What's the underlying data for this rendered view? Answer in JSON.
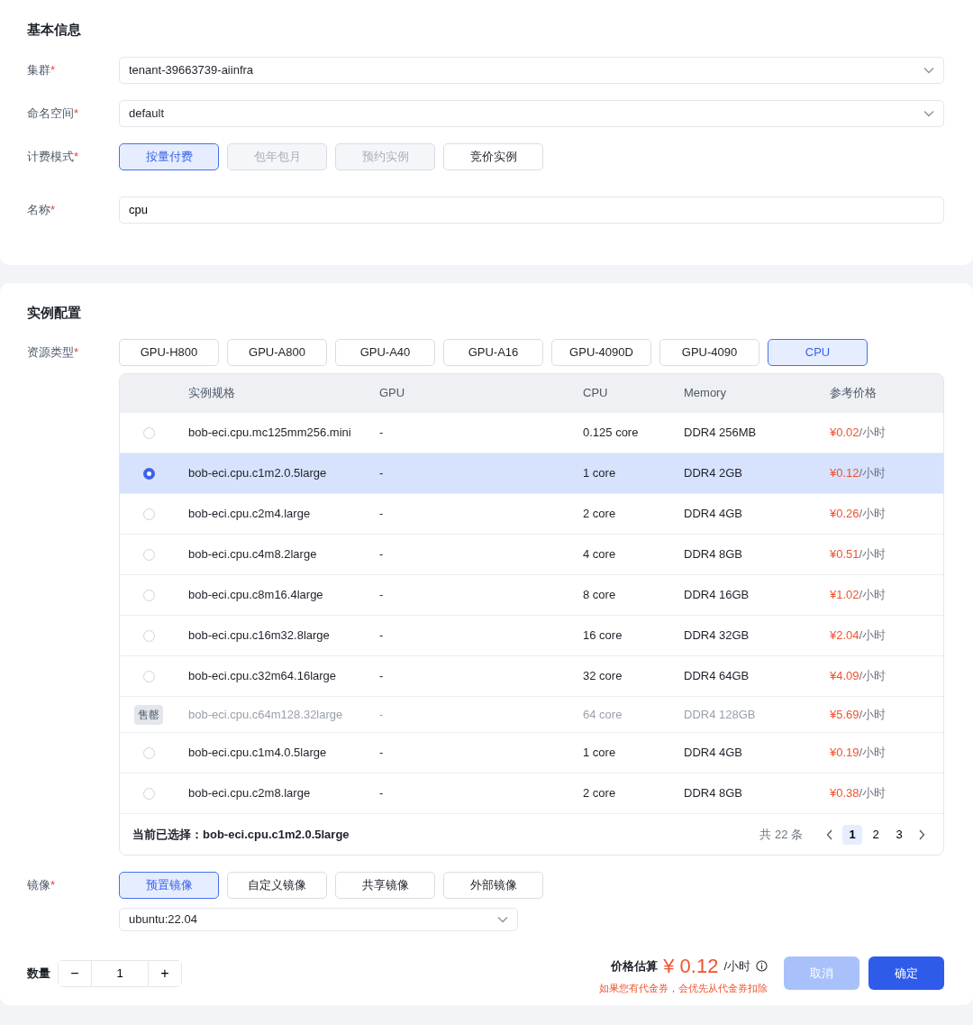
{
  "basic": {
    "title": "基本信息",
    "cluster": {
      "label": "集群",
      "required_mark": "*",
      "value": "tenant-39663739-aiinfra"
    },
    "namespace": {
      "label": "命名空间",
      "required_mark": "*",
      "value": "default"
    },
    "billing": {
      "label": "计费模式",
      "required_mark": "*",
      "options": [
        {
          "label": "按量付费",
          "selected": true,
          "disabled": false
        },
        {
          "label": "包年包月",
          "selected": false,
          "disabled": true
        },
        {
          "label": "预约实例",
          "selected": false,
          "disabled": true
        },
        {
          "label": "竞价实例",
          "selected": false,
          "disabled": false
        }
      ]
    },
    "name": {
      "label": "名称",
      "required_mark": "*",
      "value": "cpu"
    }
  },
  "instance": {
    "title": "实例配置",
    "resource_type": {
      "label": "资源类型",
      "required_mark": "*",
      "options": [
        {
          "label": "GPU-H800",
          "selected": false
        },
        {
          "label": "GPU-A800",
          "selected": false
        },
        {
          "label": "GPU-A40",
          "selected": false
        },
        {
          "label": "GPU-A16",
          "selected": false
        },
        {
          "label": "GPU-4090D",
          "selected": false
        },
        {
          "label": "GPU-4090",
          "selected": false
        },
        {
          "label": "CPU",
          "selected": true
        }
      ]
    },
    "table": {
      "columns": [
        "实例规格",
        "GPU",
        "CPU",
        "Memory",
        "参考价格"
      ],
      "rows": [
        {
          "kind": "radio",
          "selected": false,
          "spec": "bob-eci.cpu.mc125mm256.mini",
          "gpu": "-",
          "cpu": "0.125 core",
          "memory": "DDR4 256MB",
          "price": "¥0.02",
          "unit": "/小时"
        },
        {
          "kind": "radio",
          "selected": true,
          "spec": "bob-eci.cpu.c1m2.0.5large",
          "gpu": "-",
          "cpu": "1 core",
          "memory": "DDR4 2GB",
          "price": "¥0.12",
          "unit": "/小时"
        },
        {
          "kind": "radio",
          "selected": false,
          "spec": "bob-eci.cpu.c2m4.large",
          "gpu": "-",
          "cpu": "2 core",
          "memory": "DDR4 4GB",
          "price": "¥0.26",
          "unit": "/小时"
        },
        {
          "kind": "radio",
          "selected": false,
          "spec": "bob-eci.cpu.c4m8.2large",
          "gpu": "-",
          "cpu": "4 core",
          "memory": "DDR4 8GB",
          "price": "¥0.51",
          "unit": "/小时"
        },
        {
          "kind": "radio",
          "selected": false,
          "spec": "bob-eci.cpu.c8m16.4large",
          "gpu": "-",
          "cpu": "8 core",
          "memory": "DDR4 16GB",
          "price": "¥1.02",
          "unit": "/小时"
        },
        {
          "kind": "radio",
          "selected": false,
          "spec": "bob-eci.cpu.c16m32.8large",
          "gpu": "-",
          "cpu": "16 core",
          "memory": "DDR4 32GB",
          "price": "¥2.04",
          "unit": "/小时"
        },
        {
          "kind": "radio",
          "selected": false,
          "spec": "bob-eci.cpu.c32m64.16large",
          "gpu": "-",
          "cpu": "32 core",
          "memory": "DDR4 64GB",
          "price": "¥4.09",
          "unit": "/小时"
        },
        {
          "kind": "sold_out",
          "badge": "售罄",
          "spec": "bob-eci.cpu.c64m128.32large",
          "gpu": "-",
          "cpu": "64 core",
          "memory": "DDR4 128GB",
          "price": "¥5.69",
          "unit": "/小时"
        },
        {
          "kind": "radio",
          "selected": false,
          "spec": "bob-eci.cpu.c1m4.0.5large",
          "gpu": "-",
          "cpu": "1 core",
          "memory": "DDR4 4GB",
          "price": "¥0.19",
          "unit": "/小时"
        },
        {
          "kind": "radio",
          "selected": false,
          "spec": "bob-eci.cpu.c2m8.large",
          "gpu": "-",
          "cpu": "2 core",
          "memory": "DDR4 8GB",
          "price": "¥0.38",
          "unit": "/小时"
        }
      ],
      "selection_label": "当前已选择：",
      "selection_value": "bob-eci.cpu.c1m2.0.5large",
      "total": "共 22 条",
      "pages": [
        {
          "label": "1",
          "selected": true
        },
        {
          "label": "2",
          "selected": false
        },
        {
          "label": "3",
          "selected": false
        }
      ]
    },
    "image": {
      "label": "镜像",
      "required_mark": "*",
      "options": [
        {
          "label": "预置镜像",
          "selected": true
        },
        {
          "label": "自定义镜像",
          "selected": false
        },
        {
          "label": "共享镜像",
          "selected": false
        },
        {
          "label": "外部镜像",
          "selected": false
        }
      ],
      "value": "ubuntu:22.04"
    }
  },
  "footer": {
    "quantity_label": "数量",
    "quantity": "1",
    "minus": "−",
    "plus": "+",
    "price_label": "价格估算",
    "price_currency": "¥",
    "price_value": "0.12",
    "price_unit": "/小时",
    "note": "如果您有代金券，会优先从代金券扣除",
    "cancel": "取消",
    "confirm": "确定"
  }
}
